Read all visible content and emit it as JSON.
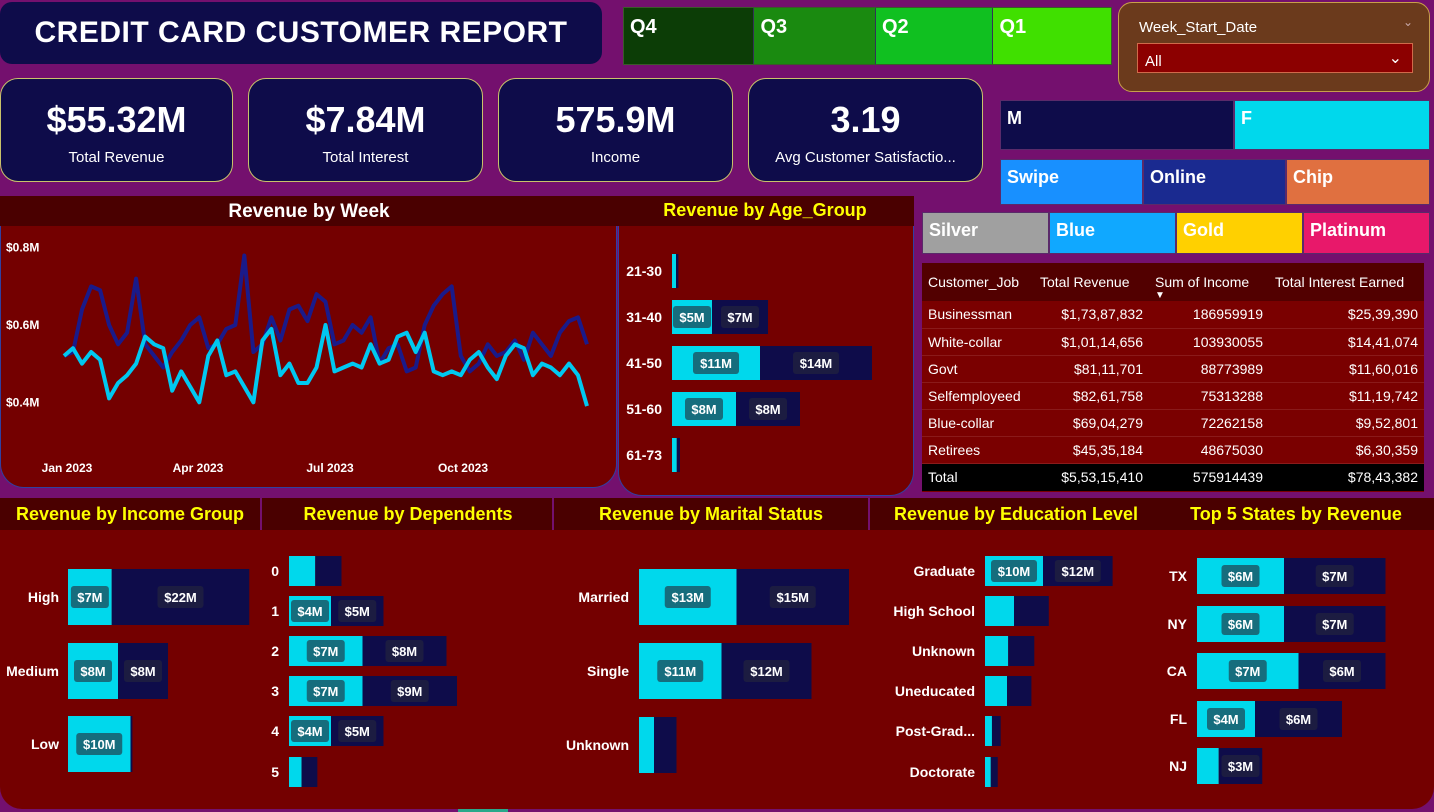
{
  "title": "CREDIT CARD CUSTOMER REPORT",
  "quarters": [
    {
      "label": "Q4",
      "color": "#0c3d06"
    },
    {
      "label": "Q3",
      "color": "#1a8a10"
    },
    {
      "label": "Q2",
      "color": "#10c020"
    },
    {
      "label": "Q1",
      "color": "#40e000"
    }
  ],
  "week_filter": {
    "label": "Week_Start_Date",
    "value": "All"
  },
  "kpis": [
    {
      "value": "$55.32M",
      "label": "Total Revenue"
    },
    {
      "value": "$7.84M",
      "label": "Total Interest"
    },
    {
      "value": "575.9M",
      "label": "Income"
    },
    {
      "value": "3.19",
      "label": "Avg Customer Satisfactio..."
    }
  ],
  "gender_slicer": [
    {
      "label": "M",
      "color": "#0e0c4a"
    },
    {
      "label": "F",
      "color": "#00d8ec"
    }
  ],
  "channel_slicer": [
    {
      "label": "Swipe",
      "color": "#1890ff"
    },
    {
      "label": "Online",
      "color": "#1a2a90"
    },
    {
      "label": "Chip",
      "color": "#e07040"
    }
  ],
  "card_slicer": [
    {
      "label": "Silver",
      "color": "#a0a0a0"
    },
    {
      "label": "Blue",
      "color": "#10a8ff"
    },
    {
      "label": "Gold",
      "color": "#ffd000"
    },
    {
      "label": "Platinum",
      "color": "#e8186a"
    }
  ],
  "job_table": {
    "headers": [
      "Customer_Job",
      "Total Revenue",
      "Sum of Income",
      "Total Interest Earned"
    ],
    "rows": [
      [
        "Businessman",
        "$1,73,87,832",
        "186959919",
        "$25,39,390"
      ],
      [
        "White-collar",
        "$1,01,14,656",
        "103930055",
        "$14,41,074"
      ],
      [
        "Govt",
        "$81,11,701",
        "88773989",
        "$11,60,016"
      ],
      [
        "Selfemployeed",
        "$82,61,758",
        "75313288",
        "$11,19,742"
      ],
      [
        "Blue-collar",
        "$69,04,279",
        "72262158",
        "$9,52,801"
      ],
      [
        "Retirees",
        "$45,35,184",
        "48675030",
        "$6,30,359"
      ]
    ],
    "total": [
      "Total",
      "$5,53,15,410",
      "575914439",
      "$78,43,382"
    ]
  },
  "colors": {
    "male": "#0e0c4a",
    "female": "#00d8ec",
    "panel": "#740000",
    "title_yellow": "#ffff00"
  },
  "chart_data": [
    {
      "type": "line",
      "title": "Revenue by Week",
      "x_ticks": [
        "Jan 2023",
        "Apr 2023",
        "Jul 2023",
        "Oct 2023"
      ],
      "y_ticks": [
        "$0.4M",
        "$0.6M",
        "$0.8M"
      ],
      "ylim": [
        0.38,
        0.82
      ],
      "series": [
        {
          "name": "M",
          "color": "#1a1a8a",
          "values": [
            0.52,
            0.53,
            0.64,
            0.7,
            0.69,
            0.6,
            0.55,
            0.58,
            0.72,
            0.55,
            0.52,
            0.49,
            0.53,
            0.56,
            0.6,
            0.62,
            0.54,
            0.55,
            0.59,
            0.6,
            0.78,
            0.53,
            0.55,
            0.62,
            0.56,
            0.64,
            0.65,
            0.61,
            0.68,
            0.66,
            0.55,
            0.56,
            0.6,
            0.58,
            0.62,
            0.5,
            0.54,
            0.55,
            0.48,
            0.49,
            0.6,
            0.65,
            0.68,
            0.7,
            0.52,
            0.48,
            0.5,
            0.55,
            0.52,
            0.53,
            0.56,
            0.51,
            0.58,
            0.55,
            0.52,
            0.58,
            0.61,
            0.62,
            0.55
          ]
        },
        {
          "name": "F",
          "color": "#00c8f0",
          "values": [
            0.52,
            0.54,
            0.5,
            0.53,
            0.51,
            0.41,
            0.45,
            0.47,
            0.5,
            0.57,
            0.55,
            0.54,
            0.43,
            0.48,
            0.44,
            0.4,
            0.52,
            0.56,
            0.47,
            0.48,
            0.44,
            0.4,
            0.56,
            0.59,
            0.47,
            0.5,
            0.45,
            0.45,
            0.49,
            0.6,
            0.48,
            0.49,
            0.5,
            0.49,
            0.55,
            0.5,
            0.51,
            0.57,
            0.58,
            0.53,
            0.58,
            0.48,
            0.47,
            0.48,
            0.47,
            0.51,
            0.53,
            0.49,
            0.46,
            0.52,
            0.55,
            0.54,
            0.47,
            0.5,
            0.49,
            0.47,
            0.5,
            0.47,
            0.39
          ]
        }
      ]
    },
    {
      "type": "bar",
      "title": "Revenue by Age_Group",
      "categories": [
        "21-30",
        "31-40",
        "41-50",
        "51-60",
        "61-73"
      ],
      "series": [
        {
          "name": "F",
          "values": [
            0.5,
            5,
            11,
            8,
            0.6
          ],
          "labels": [
            "",
            "$5M",
            "$11M",
            "$8M",
            ""
          ]
        },
        {
          "name": "M",
          "values": [
            0.3,
            7,
            14,
            8,
            0.4
          ],
          "labels": [
            "",
            "$7M",
            "$14M",
            "$8M",
            ""
          ]
        }
      ]
    },
    {
      "type": "bar",
      "title": "Revenue by Income Group",
      "categories": [
        "High",
        "Medium",
        "Low"
      ],
      "series": [
        {
          "name": "F",
          "values": [
            7,
            8,
            10
          ],
          "labels": [
            "$7M",
            "$8M",
            "$10M"
          ]
        },
        {
          "name": "M",
          "values": [
            22,
            8,
            0.3
          ],
          "labels": [
            "$22M",
            "$8M",
            ""
          ]
        }
      ]
    },
    {
      "type": "bar",
      "title": "Revenue by Dependents",
      "categories": [
        "0",
        "1",
        "2",
        "3",
        "4",
        "5"
      ],
      "series": [
        {
          "name": "F",
          "values": [
            2.5,
            4,
            7,
            7,
            4,
            1.2
          ],
          "labels": [
            "",
            "$4M",
            "$7M",
            "$7M",
            "$4M",
            ""
          ]
        },
        {
          "name": "M",
          "values": [
            2.5,
            5,
            8,
            9,
            5,
            1.5
          ],
          "labels": [
            "",
            "$5M",
            "$8M",
            "$9M",
            "$5M",
            ""
          ]
        }
      ]
    },
    {
      "type": "bar",
      "title": "Revenue by Marital Status",
      "categories": [
        "Married",
        "Single",
        "Unknown"
      ],
      "series": [
        {
          "name": "F",
          "values": [
            13,
            11,
            2
          ],
          "labels": [
            "$13M",
            "$11M",
            ""
          ]
        },
        {
          "name": "M",
          "values": [
            15,
            12,
            3
          ],
          "labels": [
            "$15M",
            "$12M",
            ""
          ]
        }
      ]
    },
    {
      "type": "bar",
      "title": "Revenue by Education Level",
      "categories": [
        "Graduate",
        "High School",
        "Unknown",
        "Uneducated",
        "Post-Grad...",
        "Doctorate"
      ],
      "series": [
        {
          "name": "F",
          "values": [
            10,
            5,
            4,
            3.8,
            1.2,
            1.0
          ],
          "labels": [
            "$10M",
            "",
            "",
            "",
            "",
            ""
          ]
        },
        {
          "name": "M",
          "values": [
            12,
            6,
            4.5,
            4.2,
            1.5,
            1.2
          ],
          "labels": [
            "$12M",
            "",
            "",
            "",
            "",
            ""
          ]
        }
      ]
    },
    {
      "type": "bar",
      "title": "Top 5 States by Revenue",
      "categories": [
        "TX",
        "NY",
        "CA",
        "FL",
        "NJ"
      ],
      "series": [
        {
          "name": "F",
          "values": [
            6,
            6,
            7,
            4,
            1.5
          ],
          "labels": [
            "$6M",
            "$6M",
            "$7M",
            "$4M",
            ""
          ]
        },
        {
          "name": "M",
          "values": [
            7,
            7,
            6,
            6,
            3
          ],
          "labels": [
            "$7M",
            "$7M",
            "$6M",
            "$6M",
            "$3M"
          ]
        }
      ]
    }
  ]
}
